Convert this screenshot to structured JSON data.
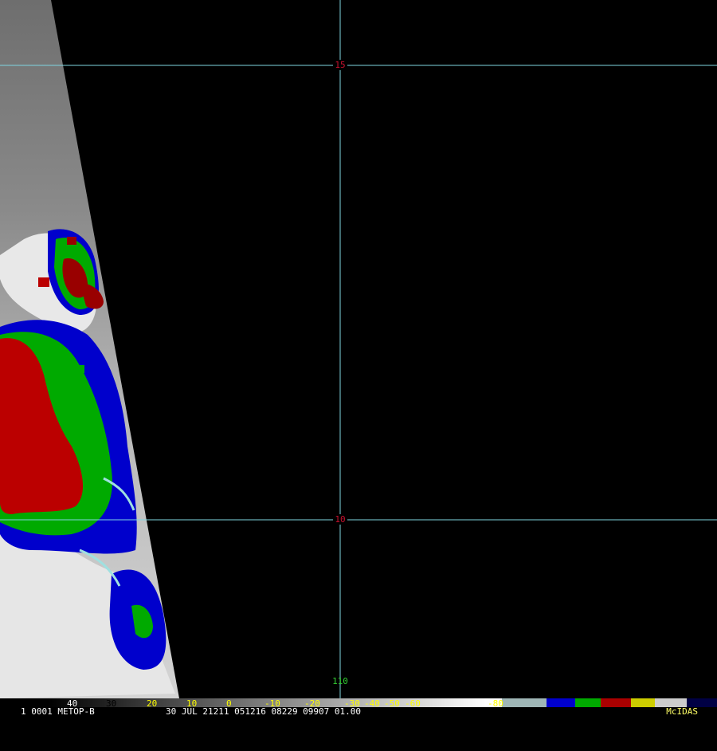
{
  "map": {
    "grid_color": "#7fd6e0",
    "latitude_labels": [
      "15",
      "10"
    ],
    "longitude_label": "110",
    "lat_label_color": "#c8102e",
    "lon_label_color": "#33cc33"
  },
  "colorbar": {
    "tick_labels_white": [
      "40",
      "30"
    ],
    "tick_labels_yellow": [
      "20",
      "10",
      "0",
      "-10",
      "-20",
      "-30",
      "-40",
      "-50",
      "-60"
    ],
    "tick_label_80": "-80",
    "segment_colors": [
      "#ffffff",
      "#9fb6b6",
      "#0000cc",
      "#00aa00",
      "#aa0000",
      "#cccc00",
      "#cccccc",
      "#000044"
    ]
  },
  "footer": {
    "left": "1 0001 METOP-B",
    "middle": "30 JUL 21211 051216 08229 09907 01.00",
    "right": "McIDAS"
  }
}
